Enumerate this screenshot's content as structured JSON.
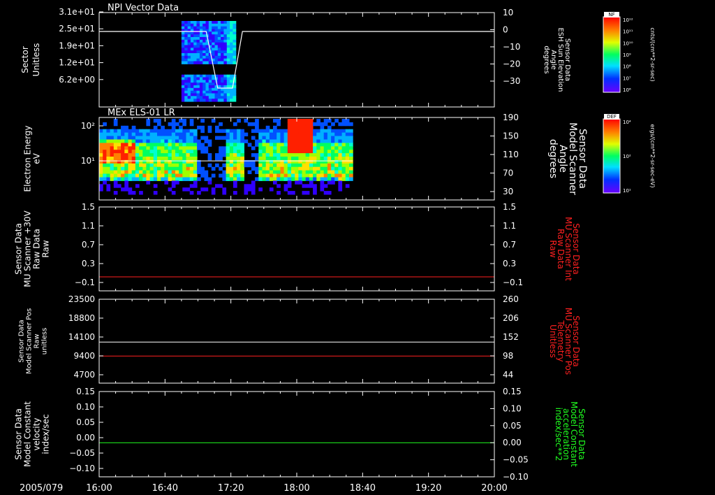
{
  "panels": [
    {
      "title": "NPI Vector Data",
      "left_label": [
        "Sector",
        "Unitless"
      ],
      "left_ticks": [
        "3.1e+01",
        "2.5e+01",
        "1.9e+01",
        "1.2e+01",
        "6.2e+00"
      ],
      "right_label": [
        "Sensor Data",
        "ESH Sun Elevation",
        "Angle",
        "degrees"
      ],
      "right_ticks": [
        "10",
        "0",
        "−10",
        "−20",
        "−30"
      ]
    },
    {
      "title": "MEx ELS-01 LR",
      "left_label": [
        "Electron Energy",
        "eV"
      ],
      "left_ticks": [
        "10²",
        "10¹"
      ],
      "right_label": [
        "Sensor Data",
        "Model Scanner",
        "Angle",
        "degrees"
      ],
      "right_ticks": [
        "190",
        "150",
        "110",
        "70",
        "30"
      ]
    },
    {
      "title": "",
      "left_label": [
        "Sensor Data",
        "MU Scanner +30V",
        "Raw Data",
        "Raw"
      ],
      "left_ticks": [
        "1.5",
        "1.1",
        "0.7",
        "0.3",
        "−0.1"
      ],
      "right_label": [
        "Sensor Data",
        "MU Scanner Int",
        "Raw Data",
        "Raw"
      ],
      "right_ticks": [
        "1.5",
        "1.1",
        "0.7",
        "0.3",
        "−0.1"
      ]
    },
    {
      "title": "",
      "left_label": [
        "Sensor Data",
        "Model Scanner Pos",
        "Raw",
        "unitless"
      ],
      "left_ticks": [
        "23500",
        "18800",
        "14100",
        "9400",
        "4700"
      ],
      "right_label": [
        "Sensor Data",
        "MU Scanner Pos",
        "Telemetry",
        "Unitless"
      ],
      "right_ticks": [
        "260",
        "206",
        "152",
        "98",
        "44"
      ]
    },
    {
      "title": "",
      "left_label": [
        "Sensor Data",
        "Model Constant",
        "velocity",
        "index/sec"
      ],
      "left_ticks": [
        "0.15",
        "0.10",
        "0.05",
        "0.00",
        "−0.05",
        "−0.10"
      ],
      "right_label": [
        "Sensor Data",
        "Model Constant",
        "acceleration",
        "index/sec**2"
      ],
      "right_ticks": [
        "0.15",
        "0.10",
        "0.05",
        "0.00",
        "−0.05",
        "−0.10"
      ]
    }
  ],
  "xaxis": {
    "date": "2005/079",
    "ticks": [
      "16:00",
      "16:40",
      "17:20",
      "18:00",
      "18:40",
      "19:20",
      "20:00"
    ]
  },
  "colorbars": [
    {
      "name": "NF",
      "units": "cnts/(cm**2-sr-sec)",
      "ticks": [
        "10¹²",
        "10¹¹",
        "10¹⁰",
        "10⁹",
        "10⁸",
        "10⁷",
        "10⁶"
      ]
    },
    {
      "name": "DEF",
      "units": "ergs/(cm**2-sr-sec-eV)",
      "ticks": [
        "10⁴",
        "10²",
        "10¹"
      ]
    }
  ],
  "colors": {
    "background": "#000000",
    "axis": "#ffffff",
    "red_trace": "#ff2020",
    "green_trace": "#20ff20",
    "white_trace": "#ffffff"
  },
  "chart_data": [
    {
      "type": "heatmap",
      "title": "NPI Vector Data",
      "xlim": [
        "16:00",
        "20:00"
      ],
      "ylabel": "Sector Unitless",
      "ylim": [
        0,
        31
      ],
      "data_span_x": [
        "16:50",
        "17:23"
      ],
      "series": [
        {
          "name": "Sensor Data ESH Sun Elevation Angle",
          "axis": "right",
          "ylim": [
            -40,
            10
          ],
          "points": [
            [
              "16:00",
              0
            ],
            [
              "17:05",
              0
            ],
            [
              "17:12",
              -30
            ],
            [
              "17:21",
              -30
            ],
            [
              "17:27",
              0
            ],
            [
              "20:00",
              0
            ]
          ]
        }
      ]
    },
    {
      "type": "heatmap",
      "title": "MEx ELS-01 LR",
      "xlim": [
        "16:00",
        "20:00"
      ],
      "ylabel": "Electron Energy eV",
      "yscale": "log",
      "ylim": [
        1,
        200
      ],
      "data_span_x": [
        "16:00",
        "18:34"
      ],
      "series": [
        {
          "name": "Sensor Data Model Scanner Angle",
          "axis": "right",
          "ylim": [
            0,
            190
          ],
          "points": [
            [
              "16:00",
              90
            ],
            [
              "18:34",
              90
            ]
          ]
        }
      ]
    },
    {
      "type": "line",
      "xlim": [
        "16:00",
        "20:00"
      ],
      "ylim": [
        -0.3,
        1.5
      ],
      "series": [
        {
          "name": "Sensor Data MU Scanner Int Raw Data",
          "axis": "right",
          "values": [
            [
              "16:00",
              0.0
            ],
            [
              "20:00",
              0.0
            ]
          ]
        }
      ]
    },
    {
      "type": "line",
      "xlim": [
        "16:00",
        "20:00"
      ],
      "series": [
        {
          "name": "Sensor Data Model Scanner Pos Raw",
          "axis": "left",
          "ylim": [
            0,
            23500
          ],
          "values": [
            [
              "16:00",
              11500
            ],
            [
              "20:00",
              11500
            ]
          ]
        },
        {
          "name": "Sensor Data MU Scanner Pos Telemetry",
          "axis": "right",
          "ylim": [
            0,
            260
          ],
          "values": [
            [
              "16:00",
              84
            ],
            [
              "20:00",
              84
            ]
          ]
        }
      ]
    },
    {
      "type": "line",
      "xlim": [
        "16:00",
        "20:00"
      ],
      "ylim": [
        -0.1,
        0.15
      ],
      "series": [
        {
          "name": "Sensor Data Model Constant acceleration",
          "axis": "right",
          "values": [
            [
              "16:00",
              0.0
            ],
            [
              "20:00",
              0.0
            ]
          ]
        }
      ]
    }
  ]
}
